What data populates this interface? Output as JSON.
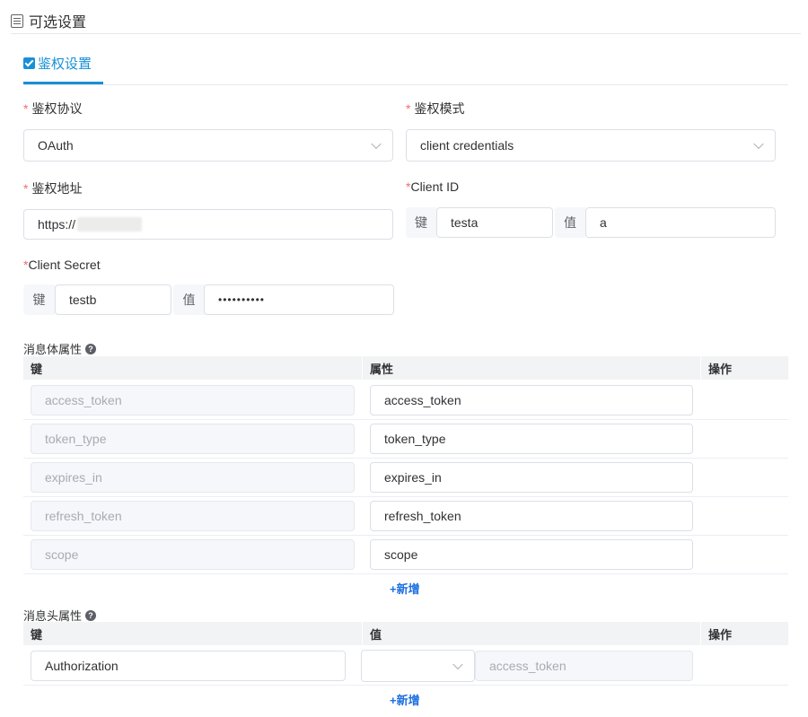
{
  "section": {
    "title": "可选设置",
    "icon": "list-icon"
  },
  "tab": {
    "label": "鉴权设置",
    "icon": "checkbox-icon",
    "accent": "#1890d6"
  },
  "form": {
    "protocol": {
      "label": "鉴权协议",
      "value": "OAuth"
    },
    "mode": {
      "label": "鉴权模式",
      "value": "client credentials"
    },
    "address": {
      "label": "鉴权地址",
      "value": "https://"
    },
    "client_id": {
      "label": "Client ID",
      "key_prefix": "键",
      "key": "testa",
      "value_prefix": "值",
      "value": "a"
    },
    "client_secret": {
      "label": "Client Secret",
      "key_prefix": "键",
      "key": "testb",
      "value_prefix": "值",
      "value": "••••••••••"
    }
  },
  "body_props": {
    "title": "消息体属性",
    "columns": [
      "键",
      "属性",
      "操作"
    ],
    "rows": [
      {
        "key": "access_token",
        "attr": "access_token"
      },
      {
        "key": "token_type",
        "attr": "token_type"
      },
      {
        "key": "expires_in",
        "attr": "expires_in"
      },
      {
        "key": "refresh_token",
        "attr": "refresh_token"
      },
      {
        "key": "scope",
        "attr": "scope"
      }
    ],
    "add_label": "+新增"
  },
  "header_props": {
    "title": "消息头属性",
    "columns": [
      "键",
      "值",
      "操作"
    ],
    "rows": [
      {
        "key": "Authorization",
        "select": "",
        "value_placeholder": "access_token"
      }
    ],
    "add_label": "+新增"
  }
}
